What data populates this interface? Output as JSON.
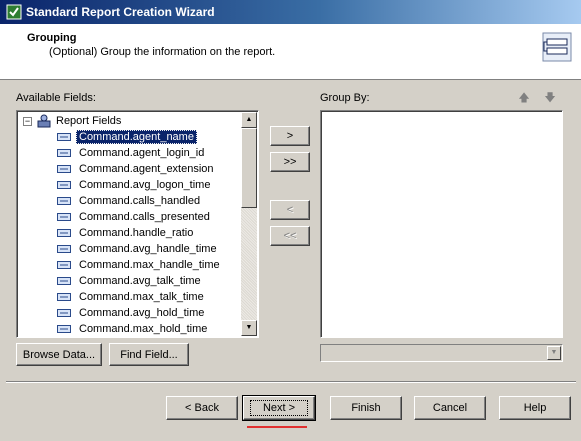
{
  "window": {
    "title": "Standard Report Creation Wizard"
  },
  "header": {
    "title": "Grouping",
    "subtitle": "(Optional) Group the information on the report."
  },
  "available": {
    "label": "Available Fields:",
    "root": "Report Fields",
    "selected_index": 0,
    "items": [
      "Command.agent_name",
      "Command.agent_login_id",
      "Command.agent_extension",
      "Command.avg_logon_time",
      "Command.calls_handled",
      "Command.calls_presented",
      "Command.handle_ratio",
      "Command.avg_handle_time",
      "Command.max_handle_time",
      "Command.avg_talk_time",
      "Command.max_talk_time",
      "Command.avg_hold_time",
      "Command.max_hold_time"
    ]
  },
  "groupby": {
    "label": "Group By:"
  },
  "transfer": {
    "add": ">",
    "add_all": ">>",
    "remove": "<",
    "remove_all": "<<"
  },
  "tools": {
    "browse": "Browse Data...",
    "find": "Find Field..."
  },
  "footer": {
    "back": "< Back",
    "next": "Next >",
    "finish": "Finish",
    "cancel": "Cancel",
    "help": "Help"
  },
  "colors": {
    "selection": "#0a246a",
    "highlight_underline": "#e03030"
  }
}
